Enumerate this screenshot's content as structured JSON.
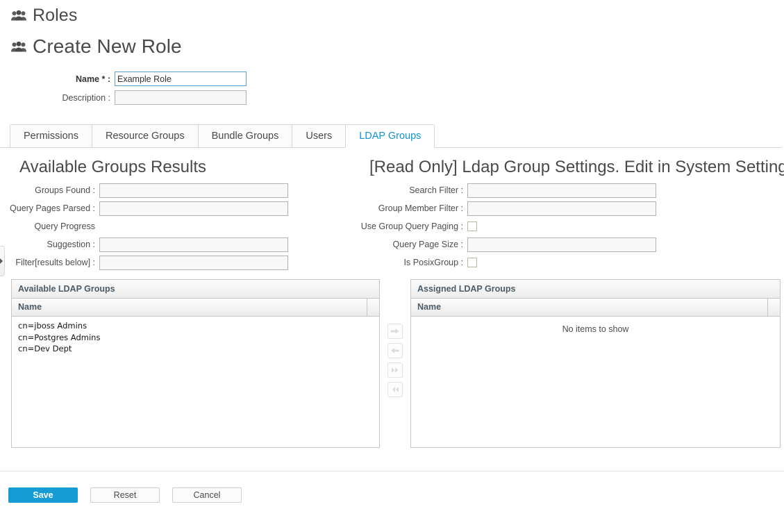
{
  "header": {
    "breadcrumb_title": "Roles",
    "page_title": "Create New Role",
    "icon": "group-people-icon"
  },
  "top_form": {
    "name_label": "Name * :",
    "name_value": "Example Role",
    "description_label": "Description :",
    "description_value": ""
  },
  "tabs": [
    {
      "label": "Permissions",
      "active": false
    },
    {
      "label": "Resource Groups",
      "active": false
    },
    {
      "label": "Bundle Groups",
      "active": false
    },
    {
      "label": "Users",
      "active": false
    },
    {
      "label": "LDAP Groups",
      "active": true
    }
  ],
  "available_groups_results": {
    "title": "Available Groups Results",
    "fields": [
      {
        "label": "Groups Found :",
        "value": "",
        "type": "text"
      },
      {
        "label": "Query Pages Parsed :",
        "value": "",
        "type": "text"
      },
      {
        "label": "Query Progress",
        "value": "",
        "type": "none"
      },
      {
        "label": "Suggestion :",
        "value": "",
        "type": "text"
      },
      {
        "label": "Filter[results below] :",
        "value": "",
        "type": "text"
      }
    ]
  },
  "ldap_settings": {
    "title": "[Read Only] Ldap Group Settings. Edit in System Settings",
    "fields": [
      {
        "label": "Search Filter :",
        "value": "",
        "type": "text"
      },
      {
        "label": "Group Member Filter :",
        "value": "",
        "type": "text"
      },
      {
        "label": "Use Group Query Paging :",
        "checked": false,
        "type": "checkbox"
      },
      {
        "label": "Query Page Size :",
        "value": "",
        "type": "text"
      },
      {
        "label": "Is PosixGroup :",
        "checked": false,
        "type": "checkbox"
      }
    ]
  },
  "available_grid": {
    "title": "Available LDAP Groups",
    "column_header": "Name",
    "rows": [
      "cn=jboss Admins",
      "cn=Postgres Admins",
      "cn=Dev Dept"
    ]
  },
  "assigned_grid": {
    "title": "Assigned LDAP Groups",
    "column_header": "Name",
    "rows": [],
    "empty_text": "No items to show"
  },
  "transfer_buttons": [
    {
      "name": "move-right-button",
      "glyph": "arrow-right-icon"
    },
    {
      "name": "move-left-button",
      "glyph": "arrow-left-icon"
    },
    {
      "name": "move-all-right-button",
      "glyph": "double-arrow-right-icon"
    },
    {
      "name": "move-all-left-button",
      "glyph": "double-arrow-left-icon"
    }
  ],
  "footer_buttons": {
    "save": "Save",
    "reset": "Reset",
    "cancel": "Cancel"
  },
  "colors": {
    "accent": "#169bd5",
    "active_tab_text": "#0f93d6",
    "focus_border": "#5a9fd4",
    "heading_text": "#4a4a4a",
    "grid_header_text": "#4c5b66"
  }
}
